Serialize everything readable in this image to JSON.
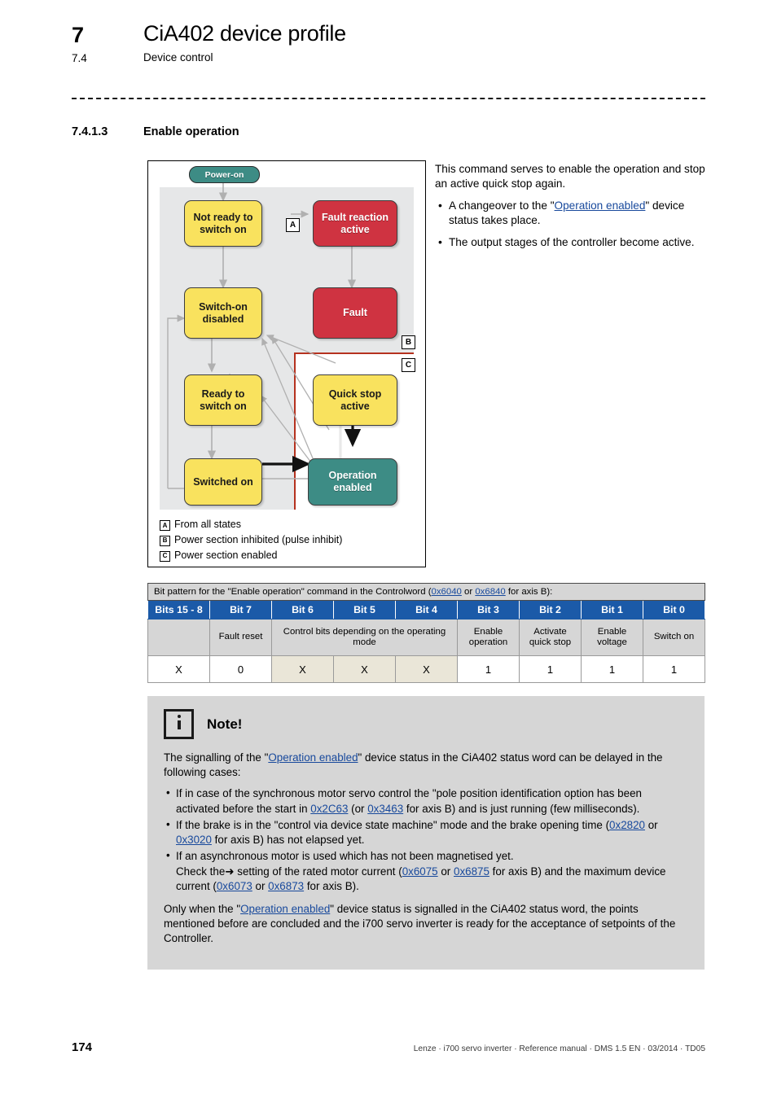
{
  "header": {
    "chapter_number": "7",
    "chapter_title": "CiA402 device profile",
    "section_number": "7.4",
    "section_title": "Device control",
    "subsection_number": "7.4.1.3",
    "subsection_title": "Enable operation"
  },
  "figure": {
    "power_on_label": "Power-on",
    "nodes": {
      "not_ready": "Not ready to switch on",
      "fault_reaction": "Fault reaction active",
      "switch_on_disabled": "Switch-on disabled",
      "fault": "Fault",
      "ready_to_switch_on": "Ready to switch on",
      "quick_stop_active": "Quick stop active",
      "switched_on": "Switched on",
      "operation_enabled": "Operation enabled"
    },
    "markers": {
      "a": "A",
      "b": "B",
      "c": "C"
    },
    "legend": [
      {
        "key": "A",
        "text": "From all states"
      },
      {
        "key": "B",
        "text": "Power section inhibited (pulse inhibit)"
      },
      {
        "key": "C",
        "text": "Power section enabled"
      }
    ],
    "colors": {
      "yellow": "#f9e25e",
      "red": "#cf3341",
      "teal": "#3d8c85",
      "panel": "#e6e7e8",
      "c_border": "#b5321f"
    }
  },
  "intro": {
    "paragraph": "This command serves to enable the operation and stop an active quick stop again.",
    "bullets": [
      {
        "before": "A changeover to the \"",
        "link": "Operation enabled",
        "after": "\" device status takes place."
      },
      {
        "before": "The output stages of the controller become active.",
        "link": "",
        "after": ""
      }
    ]
  },
  "table": {
    "caption": {
      "before": "Bit pattern for the \"Enable operation\" command in the Controlword (",
      "link1": "0x6040",
      "mid": " or ",
      "link2": "0x6840",
      "after": " for axis B):"
    },
    "headers": [
      "Bits 15 - 8",
      "Bit 7",
      "Bit 6",
      "Bit 5",
      "Bit 4",
      "Bit 3",
      "Bit 2",
      "Bit 1",
      "Bit 0"
    ],
    "descriptions": {
      "bits15_8": "",
      "bit7": "Fault reset",
      "bits6_4": "Control bits depending on the operating mode",
      "bit3": "Enable operation",
      "bit2": "Activate quick stop",
      "bit1": "Enable voltage",
      "bit0": "Switch on"
    },
    "values": [
      "X",
      "0",
      "X",
      "X",
      "X",
      "1",
      "1",
      "1",
      "1"
    ],
    "header_color": "#1b5aa8"
  },
  "note": {
    "title": "Note!",
    "intro": {
      "before": "The signalling of the \"",
      "link": "Operation enabled",
      "after": "\" device status in the CiA402 status word can be delayed in the following cases:"
    },
    "bullets": [
      {
        "p1": "If in case of the synchronous motor servo control the \"pole position identification option has been activated before the start in ",
        "l1": "0x2C63",
        "p2": " (or ",
        "l2": "0x3463",
        "p3": " for axis B) and is just running (few milliseconds)."
      },
      {
        "p1": "If the brake is in the \"control via device state machine\" mode and the brake opening time (",
        "l1": "0x2820",
        "p2": " or ",
        "l2": "0x3020",
        "p3": " for axis B) has not elapsed yet."
      }
    ],
    "bullet3": {
      "line1": "If an asynchronous motor is used which has not been magnetised yet.",
      "p1": "Check the",
      "arrow": "➜",
      "p2": " setting of the rated motor current (",
      "l1": "0x6075",
      "p3": " or ",
      "l2": "0x6875",
      "p4": " for axis B) and the maximum device current (",
      "l3": "0x6073",
      "p5": " or ",
      "l4": "0x6873",
      "p6": " for axis B)."
    },
    "closing": {
      "before": "Only when the \"",
      "link": "Operation enabled",
      "after": "\" device status is signalled in the CiA402 status word, the points mentioned before are concluded and the i700 servo inverter is ready for the acceptance of setpoints of the Controller."
    }
  },
  "footer": {
    "page_number": "174",
    "text": "Lenze · i700 servo inverter · Reference manual · DMS 1.5 EN · 03/2014 · TD05"
  }
}
